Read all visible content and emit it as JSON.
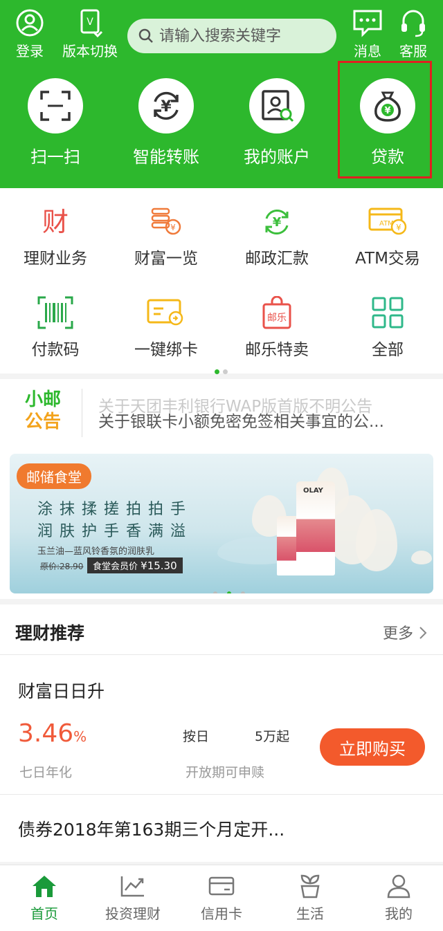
{
  "header": {
    "login_label": "登录",
    "version_label": "版本切换",
    "search_placeholder": "请输入搜索关键字",
    "message_label": "消息",
    "service_label": "客服",
    "quick_actions": [
      {
        "label": "扫一扫",
        "icon": "scan-icon"
      },
      {
        "label": "智能转账",
        "icon": "transfer-icon"
      },
      {
        "label": "我的账户",
        "icon": "account-icon"
      },
      {
        "label": "贷款",
        "icon": "loan-bag-icon"
      }
    ]
  },
  "menu": {
    "items": [
      {
        "label": "理财业务",
        "icon": "wealth-icon"
      },
      {
        "label": "财富一览",
        "icon": "coins-icon"
      },
      {
        "label": "邮政汇款",
        "icon": "remittance-icon"
      },
      {
        "label": "ATM交易",
        "icon": "atm-card-icon"
      },
      {
        "label": "付款码",
        "icon": "barcode-icon"
      },
      {
        "label": "一键绑卡",
        "icon": "bind-card-icon"
      },
      {
        "label": "邮乐特卖",
        "icon": "shopping-bag-icon"
      },
      {
        "label": "全部",
        "icon": "grid-icon"
      }
    ]
  },
  "notice": {
    "logo_line1": "小邮",
    "logo_line2": "公告",
    "ghost_text": "关于天团丰利银行WAP版首版不明公告",
    "current_text": "关于银联卡小额免密免签相关事宜的公..."
  },
  "banner": {
    "tag": "邮储食堂",
    "line1": "涂抹揉搓拍拍手",
    "line2": "润肤护手香满溢",
    "subtitle": "玉兰油—蓝风铃香氛的润肤乳",
    "original_price": "原价:28.90",
    "member_label": "食堂会员价",
    "member_price": "¥15.30",
    "brand": "OLAY"
  },
  "recommend": {
    "title": "理财推荐",
    "more": "更多",
    "product1": {
      "name": "财富日日升",
      "rate": "3.46",
      "rate_unit": "%",
      "rate_label": "七日年化",
      "type": "按日",
      "minimum": "5万起",
      "period": "开放期可申赎",
      "buy_label": "立即购买"
    },
    "product2": {
      "name": "债券2018年第163期三个月定开..."
    }
  },
  "tabbar": {
    "tabs": [
      {
        "label": "首页",
        "icon": "home-icon"
      },
      {
        "label": "投资理财",
        "icon": "invest-chart-icon"
      },
      {
        "label": "信用卡",
        "icon": "credit-card-icon"
      },
      {
        "label": "生活",
        "icon": "life-plant-icon"
      },
      {
        "label": "我的",
        "icon": "user-icon"
      }
    ],
    "active_color": "#1a9a3a"
  },
  "colors": {
    "brand_green": "#2db82d",
    "accent_orange": "#f35a2c",
    "rate_red": "#f05a3a",
    "highlight_red": "#e02020"
  }
}
